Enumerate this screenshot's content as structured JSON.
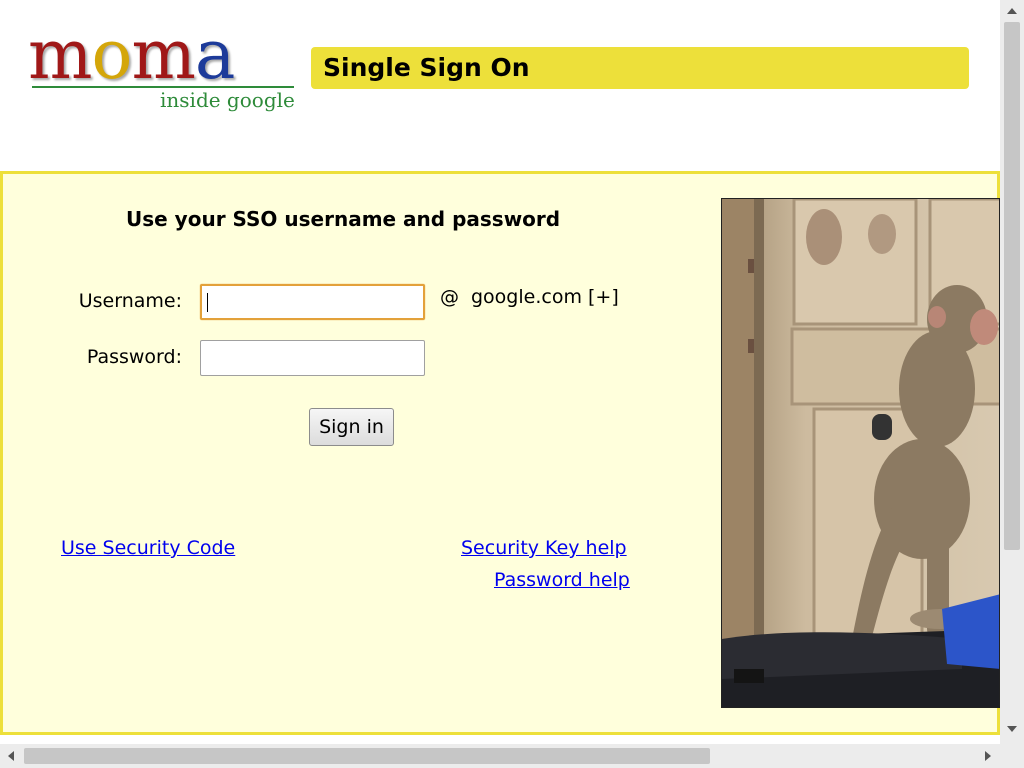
{
  "header": {
    "logo": {
      "letters": [
        {
          "ch": "m",
          "color": "#a01818"
        },
        {
          "ch": "o",
          "color": "#d4a60a"
        },
        {
          "ch": "m",
          "color": "#a01818"
        },
        {
          "ch": "a",
          "color": "#1d3b9a"
        }
      ],
      "subtitle": "inside google"
    },
    "title": "Single Sign On"
  },
  "form": {
    "heading": "Use your SSO username and password",
    "username_label": "Username:",
    "username_value": "",
    "password_label": "Password:",
    "password_value": "",
    "domain_at": "@",
    "domain": "google.com [+]",
    "sign_in": "Sign in"
  },
  "links": {
    "security_code": "Use Security Code",
    "security_key_help": "Security Key help",
    "password_help": "Password help"
  },
  "colors": {
    "title_bar": "#ede03a",
    "panel_bg": "#ffffdc",
    "link": "#0000ee",
    "focus_border": "#e3a13a"
  }
}
